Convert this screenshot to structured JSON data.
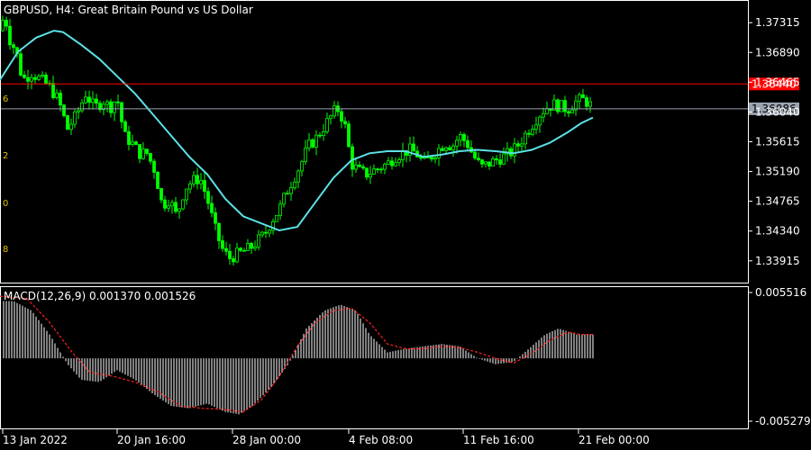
{
  "window_title": "GBPUSD, H4:  Great Britain Pound vs US Dollar",
  "indicator_title": "MACD(12,26,9) 0.001370 0.001526",
  "colors": {
    "background": "#000000",
    "frame": "#ffffff",
    "bull_candle": "#00ff00",
    "moving_average": "#5ce1e6",
    "bid_line": "#ff0000",
    "ask_line": "#9aa3b0",
    "macd_hist": "#ffffff",
    "macd_signal": "#ff2020",
    "level_labels": "#e0c000"
  },
  "price_axis": {
    "ticks": [
      "1.37315",
      "1.36890",
      "1.36465",
      "1.36040",
      "1.35615",
      "1.35190",
      "1.34765",
      "1.34340",
      "1.33915"
    ],
    "bid_label": "1.36440",
    "ask_label": "1.36086"
  },
  "macd_axis": {
    "ticks": [
      "0.005516",
      "-0.005279"
    ]
  },
  "time_axis": {
    "ticks": [
      "13 Jan 2022",
      "20 Jan 16:00",
      "28 Jan 00:00",
      "4 Feb 08:00",
      "11 Feb 16:00",
      "21 Feb 00:00"
    ]
  },
  "level_labels": [
    "6",
    "2",
    "0",
    "8"
  ],
  "chart_data": [
    {
      "type": "candlestick",
      "title": "GBPUSD, H4:  Great Britain Pound vs US Dollar",
      "ylim": [
        1.3363,
        1.376
      ],
      "y_ticks": [
        1.37315,
        1.3689,
        1.36465,
        1.3604,
        1.35615,
        1.3519,
        1.34765,
        1.3434,
        1.33915
      ],
      "x_ticks": [
        "13 Jan 2022",
        "20 Jan 16:00",
        "28 Jan 00:00",
        "4 Feb 08:00",
        "11 Feb 16:00",
        "21 Feb 00:00"
      ],
      "bid": 1.3644,
      "ask": 1.36086,
      "close_path": [
        [
          0,
          1.372
        ],
        [
          5,
          1.3745
        ],
        [
          10,
          1.371
        ],
        [
          18,
          1.369
        ],
        [
          25,
          1.365
        ],
        [
          35,
          1.366
        ],
        [
          45,
          1.365
        ],
        [
          55,
          1.364
        ],
        [
          65,
          1.362
        ],
        [
          75,
          1.358
        ],
        [
          85,
          1.36
        ],
        [
          95,
          1.363
        ],
        [
          105,
          1.361
        ],
        [
          115,
          1.362
        ],
        [
          122,
          1.361
        ],
        [
          130,
          1.3625
        ],
        [
          138,
          1.357
        ],
        [
          146,
          1.356
        ],
        [
          155,
          1.3545
        ],
        [
          163,
          1.3545
        ],
        [
          172,
          1.352
        ],
        [
          180,
          1.347
        ],
        [
          188,
          1.348
        ],
        [
          196,
          1.3455
        ],
        [
          205,
          1.3495
        ],
        [
          213,
          1.3505
        ],
        [
          222,
          1.351
        ],
        [
          230,
          1.348
        ],
        [
          238,
          1.344
        ],
        [
          246,
          1.341
        ],
        [
          254,
          1.3395
        ],
        [
          262,
          1.34
        ],
        [
          270,
          1.3405
        ],
        [
          278,
          1.341
        ],
        [
          286,
          1.342
        ],
        [
          294,
          1.343
        ],
        [
          302,
          1.345
        ],
        [
          310,
          1.3465
        ],
        [
          318,
          1.349
        ],
        [
          326,
          1.351
        ],
        [
          334,
          1.353
        ],
        [
          342,
          1.3555
        ],
        [
          350,
          1.3565
        ],
        [
          358,
          1.358
        ],
        [
          366,
          1.3595
        ],
        [
          374,
          1.361
        ],
        [
          382,
          1.359
        ],
        [
          390,
          1.353
        ],
        [
          398,
          1.352
        ],
        [
          406,
          1.3515
        ],
        [
          414,
          1.352
        ],
        [
          422,
          1.3525
        ],
        [
          430,
          1.353
        ],
        [
          438,
          1.354
        ],
        [
          446,
          1.3545
        ],
        [
          454,
          1.355
        ],
        [
          462,
          1.3545
        ],
        [
          470,
          1.353
        ],
        [
          478,
          1.354
        ],
        [
          486,
          1.355
        ],
        [
          494,
          1.356
        ],
        [
          502,
          1.3555
        ],
        [
          510,
          1.357
        ],
        [
          518,
          1.356
        ],
        [
          526,
          1.354
        ],
        [
          534,
          1.3525
        ],
        [
          542,
          1.353
        ],
        [
          550,
          1.3535
        ],
        [
          558,
          1.354
        ],
        [
          566,
          1.3545
        ],
        [
          574,
          1.3555
        ],
        [
          582,
          1.357
        ],
        [
          590,
          1.3585
        ],
        [
          598,
          1.36
        ],
        [
          606,
          1.361
        ],
        [
          614,
          1.3615
        ],
        [
          622,
          1.3612
        ],
        [
          630,
          1.3608
        ],
        [
          638,
          1.3618
        ],
        [
          646,
          1.3622
        ],
        [
          652,
          1.3618
        ],
        [
          658,
          1.361
        ]
      ],
      "moving_average": [
        [
          0,
          1.365
        ],
        [
          20,
          1.369
        ],
        [
          40,
          1.371
        ],
        [
          60,
          1.372
        ],
        [
          70,
          1.3718
        ],
        [
          90,
          1.37
        ],
        [
          110,
          1.368
        ],
        [
          130,
          1.3655
        ],
        [
          150,
          1.363
        ],
        [
          170,
          1.36
        ],
        [
          190,
          1.357
        ],
        [
          210,
          1.354
        ],
        [
          230,
          1.3515
        ],
        [
          250,
          1.348
        ],
        [
          270,
          1.3455
        ],
        [
          290,
          1.3445
        ],
        [
          310,
          1.3435
        ],
        [
          330,
          1.344
        ],
        [
          350,
          1.3475
        ],
        [
          370,
          1.351
        ],
        [
          390,
          1.3535
        ],
        [
          410,
          1.3545
        ],
        [
          430,
          1.3548
        ],
        [
          450,
          1.3548
        ],
        [
          470,
          1.354
        ],
        [
          490,
          1.3543
        ],
        [
          510,
          1.3548
        ],
        [
          530,
          1.355
        ],
        [
          550,
          1.3548
        ],
        [
          570,
          1.3545
        ],
        [
          590,
          1.355
        ],
        [
          610,
          1.356
        ],
        [
          630,
          1.3575
        ],
        [
          645,
          1.3588
        ],
        [
          658,
          1.3596
        ]
      ]
    },
    {
      "type": "bar",
      "title": "MACD(12,26,9) 0.001370 0.001526",
      "ylim": [
        -0.005279,
        0.005516
      ],
      "y_ticks": [
        0.005516,
        -0.005279
      ],
      "hist_path": [
        [
          0,
          0.0048
        ],
        [
          15,
          0.0048
        ],
        [
          35,
          0.004
        ],
        [
          55,
          0.002
        ],
        [
          75,
          -0.0005
        ],
        [
          90,
          -0.0018
        ],
        [
          110,
          -0.002
        ],
        [
          130,
          -0.001
        ],
        [
          150,
          -0.0018
        ],
        [
          170,
          -0.003
        ],
        [
          190,
          -0.004
        ],
        [
          210,
          -0.0042
        ],
        [
          230,
          -0.0038
        ],
        [
          250,
          -0.0045
        ],
        [
          265,
          -0.0047
        ],
        [
          280,
          -0.004
        ],
        [
          300,
          -0.0025
        ],
        [
          320,
          -0.0005
        ],
        [
          340,
          0.0025
        ],
        [
          360,
          0.004
        ],
        [
          378,
          0.0045
        ],
        [
          395,
          0.004
        ],
        [
          410,
          0.002
        ],
        [
          430,
          0.0005
        ],
        [
          450,
          0.0008
        ],
        [
          470,
          0.001
        ],
        [
          490,
          0.0012
        ],
        [
          510,
          0.001
        ],
        [
          530,
          0.0
        ],
        [
          550,
          -0.0005
        ],
        [
          570,
          -0.0003
        ],
        [
          590,
          0.001
        ],
        [
          605,
          0.002
        ],
        [
          620,
          0.0025
        ],
        [
          640,
          0.002
        ],
        [
          660,
          0.002
        ]
      ],
      "signal_path": [
        [
          0,
          0.0052
        ],
        [
          30,
          0.005
        ],
        [
          55,
          0.003
        ],
        [
          80,
          0.0005
        ],
        [
          100,
          -0.0012
        ],
        [
          125,
          -0.0015
        ],
        [
          150,
          -0.002
        ],
        [
          175,
          -0.0028
        ],
        [
          200,
          -0.004
        ],
        [
          225,
          -0.0042
        ],
        [
          250,
          -0.0043
        ],
        [
          270,
          -0.0045
        ],
        [
          290,
          -0.0035
        ],
        [
          310,
          -0.0015
        ],
        [
          330,
          0.001
        ],
        [
          350,
          0.003
        ],
        [
          370,
          0.004
        ],
        [
          390,
          0.0042
        ],
        [
          410,
          0.003
        ],
        [
          430,
          0.0012
        ],
        [
          450,
          0.0008
        ],
        [
          470,
          0.0008
        ],
        [
          490,
          0.001
        ],
        [
          510,
          0.0009
        ],
        [
          530,
          0.0005
        ],
        [
          550,
          0.0
        ],
        [
          570,
          -0.0004
        ],
        [
          590,
          0.0004
        ],
        [
          610,
          0.0015
        ],
        [
          630,
          0.0022
        ],
        [
          645,
          0.002
        ],
        [
          660,
          0.002
        ]
      ]
    }
  ]
}
